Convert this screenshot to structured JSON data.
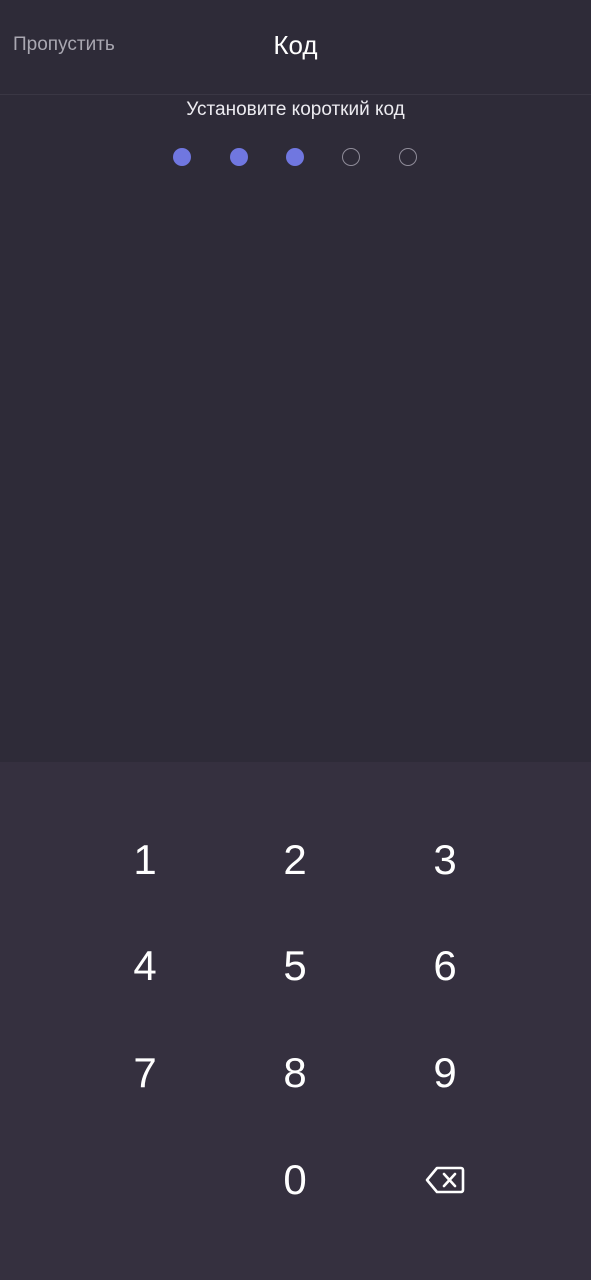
{
  "header": {
    "skip_label": "Пропустить",
    "title": "Код"
  },
  "subtitle": "Установите короткий код",
  "pin": {
    "length": 5,
    "entered": 3,
    "filled_color": "#7077e0"
  },
  "keypad": {
    "keys": [
      "1",
      "2",
      "3",
      "4",
      "5",
      "6",
      "7",
      "8",
      "9",
      "0"
    ],
    "backspace_icon": "backspace-icon"
  },
  "colors": {
    "background": "#2e2b38",
    "keypad_background": "#35303f"
  }
}
